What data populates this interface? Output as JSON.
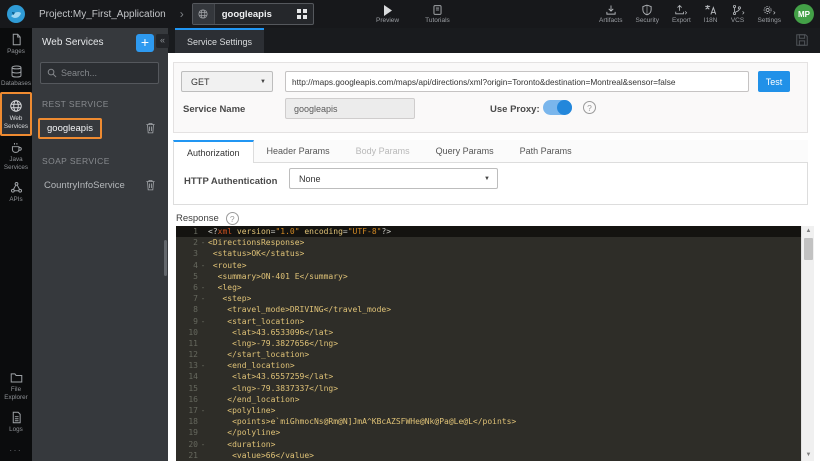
{
  "topbar": {
    "project": "Project:My_First_Application",
    "service": "googleapis",
    "preview": "Preview",
    "tutorials": "Tutorials",
    "actions": [
      "Artifacts",
      "Security",
      "Export",
      "I18N",
      "VCS",
      "Settings"
    ],
    "avatar": "MP"
  },
  "sidebar": {
    "items": [
      "Pages",
      "Databases",
      "Web Services",
      "Java Services",
      "APIs"
    ],
    "bottom": [
      "File Explorer",
      "Logs"
    ],
    "more": "..."
  },
  "panel": {
    "title": "Web Services",
    "plus": "+",
    "collapse": "«",
    "search_placeholder": "Search...",
    "rest_label": "REST SERVICE",
    "rest_item": "googleapis",
    "soap_label": "SOAP SERVICE",
    "soap_item": "CountryInfoService"
  },
  "main": {
    "tab": "Service Settings",
    "method": "GET",
    "url": "http://maps.googleapis.com/maps/api/directions/xml?origin=Toronto&destination=Montreal&sensor=false",
    "test": "Test",
    "service_name_label": "Service Name",
    "service_name_value": "googleapis",
    "use_proxy_label": "Use Proxy:",
    "tabs": [
      "Authorization",
      "Header Params",
      "Body Params",
      "Query Params",
      "Path Params"
    ],
    "http_auth_label": "HTTP Authentication",
    "http_auth_value": "None",
    "response_label": "Response"
  },
  "colors": {
    "accent_blue": "#2196f3",
    "selection_orange": "#ef8b31",
    "avatar_green": "#43a047",
    "editor_bg": "#2e2d28",
    "editor_tag": "#dfc277",
    "editor_keyword": "#cd5120",
    "editor_string": "#d28a25"
  },
  "editor": {
    "lines": [
      {
        "n": 1,
        "fold": false,
        "active": true,
        "segs": [
          {
            "t": "<?",
            "c": "p"
          },
          {
            "t": "xml",
            "c": "k"
          },
          {
            "t": " version",
            "c": "t"
          },
          {
            "t": "=",
            "c": "p"
          },
          {
            "t": "\"1.0\"",
            "c": "s"
          },
          {
            "t": " encoding",
            "c": "t"
          },
          {
            "t": "=",
            "c": "p"
          },
          {
            "t": "\"UTF-8\"",
            "c": "s"
          },
          {
            "t": "?>",
            "c": "p"
          }
        ]
      },
      {
        "n": 2,
        "fold": true,
        "segs": [
          {
            "t": "<DirectionsResponse>",
            "c": "t"
          }
        ]
      },
      {
        "n": 3,
        "fold": false,
        "segs": [
          {
            "t": " <status>OK</status>",
            "c": "t"
          }
        ]
      },
      {
        "n": 4,
        "fold": true,
        "segs": [
          {
            "t": " <route>",
            "c": "t"
          }
        ]
      },
      {
        "n": 5,
        "fold": false,
        "segs": [
          {
            "t": "  <summary>ON-401 E</summary>",
            "c": "t"
          }
        ]
      },
      {
        "n": 6,
        "fold": true,
        "segs": [
          {
            "t": "  <leg>",
            "c": "t"
          }
        ]
      },
      {
        "n": 7,
        "fold": true,
        "segs": [
          {
            "t": "   <step>",
            "c": "t"
          }
        ]
      },
      {
        "n": 8,
        "fold": false,
        "segs": [
          {
            "t": "    <travel_mode>DRIVING</travel_mode>",
            "c": "t"
          }
        ]
      },
      {
        "n": 9,
        "fold": true,
        "segs": [
          {
            "t": "    <start_location>",
            "c": "t"
          }
        ]
      },
      {
        "n": 10,
        "fold": false,
        "segs": [
          {
            "t": "     <lat>43.6533096</lat>",
            "c": "t"
          }
        ]
      },
      {
        "n": 11,
        "fold": false,
        "segs": [
          {
            "t": "     <lng>-79.3827656</lng>",
            "c": "t"
          }
        ]
      },
      {
        "n": 12,
        "fold": false,
        "segs": [
          {
            "t": "    </start_location>",
            "c": "t"
          }
        ]
      },
      {
        "n": 13,
        "fold": true,
        "segs": [
          {
            "t": "    <end_location>",
            "c": "t"
          }
        ]
      },
      {
        "n": 14,
        "fold": false,
        "segs": [
          {
            "t": "     <lat>43.6557259</lat>",
            "c": "t"
          }
        ]
      },
      {
        "n": 15,
        "fold": false,
        "segs": [
          {
            "t": "     <lng>-79.3837337</lng>",
            "c": "t"
          }
        ]
      },
      {
        "n": 16,
        "fold": false,
        "segs": [
          {
            "t": "    </end_location>",
            "c": "t"
          }
        ]
      },
      {
        "n": 17,
        "fold": true,
        "segs": [
          {
            "t": "    <polyline>",
            "c": "t"
          }
        ]
      },
      {
        "n": 18,
        "fold": false,
        "segs": [
          {
            "t": "     <points>e`miGhmocNs@Rm@N]JmA^KBcAZSFWHe@Nk@Pa@Le@L</points>",
            "c": "t"
          }
        ]
      },
      {
        "n": 19,
        "fold": false,
        "segs": [
          {
            "t": "    </polyline>",
            "c": "t"
          }
        ]
      },
      {
        "n": 20,
        "fold": true,
        "segs": [
          {
            "t": "    <duration>",
            "c": "t"
          }
        ]
      },
      {
        "n": 21,
        "fold": false,
        "segs": [
          {
            "t": "     <value>66</value>",
            "c": "t"
          }
        ]
      }
    ]
  }
}
